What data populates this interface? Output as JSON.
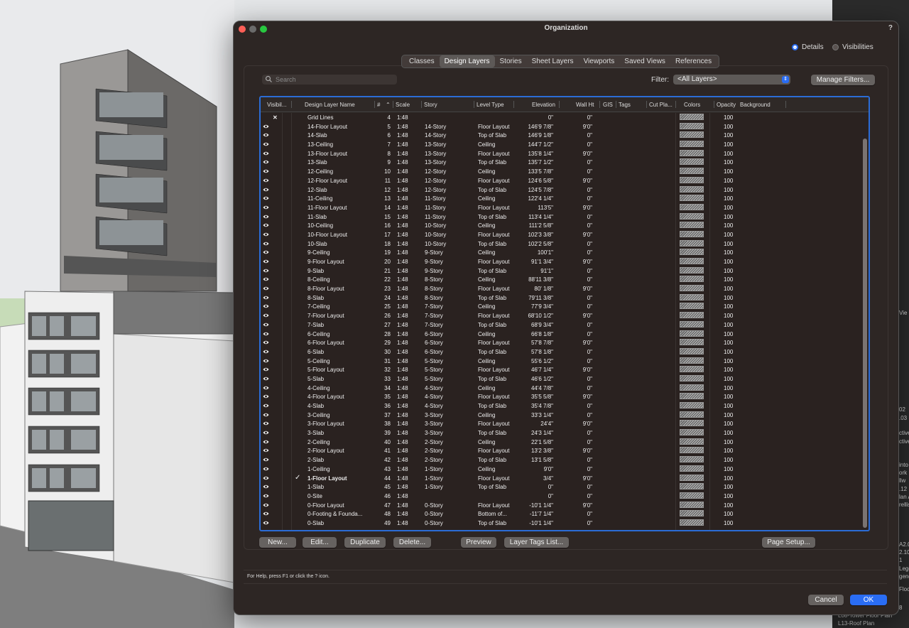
{
  "dialog": {
    "title": "Organization",
    "help": "?",
    "modes": {
      "details": "Details",
      "visibilities": "Visibilities"
    },
    "tabs": [
      "Classes",
      "Design Layers",
      "Stories",
      "Sheet Layers",
      "Viewports",
      "Saved Views",
      "References"
    ],
    "active_tab": "Design Layers",
    "search_placeholder": "Search",
    "filter_label": "Filter:",
    "filter_value": "<All Layers>",
    "manage_filters": "Manage Filters...",
    "columns": {
      "visibility": "Visibil...",
      "name": "Design Layer Name",
      "num": "#",
      "scale": "Scale",
      "story": "Story",
      "level": "Level Type",
      "elevation": "Elevation",
      "wall": "Wall Ht",
      "gis": "GIS",
      "tags": "Tags",
      "cut": "Cut Pla...",
      "colors": "Colors",
      "opacity": "Opacity",
      "background": "Background"
    },
    "rows": [
      {
        "vis": "hidden",
        "active": false,
        "name": "Grid Lines",
        "num": "4",
        "scale": "1:48",
        "story": "",
        "level": "",
        "elev": "0\"",
        "wall": "0\"",
        "opacity": "100"
      },
      {
        "vis": "visible",
        "active": false,
        "name": "14-Floor Layout",
        "num": "5",
        "scale": "1:48",
        "story": "14-Story",
        "level": "Floor Layout",
        "elev": "146'9 7/8\"",
        "wall": "9'0\"",
        "opacity": "100"
      },
      {
        "vis": "visible",
        "active": false,
        "name": "14-Slab",
        "num": "6",
        "scale": "1:48",
        "story": "14-Story",
        "level": "Top of Slab",
        "elev": "146'9 1/8\"",
        "wall": "0\"",
        "opacity": "100"
      },
      {
        "vis": "visible",
        "active": false,
        "name": "13-Ceiling",
        "num": "7",
        "scale": "1:48",
        "story": "13-Story",
        "level": "Ceiling",
        "elev": "144'7 1/2\"",
        "wall": "0\"",
        "opacity": "100"
      },
      {
        "vis": "visible",
        "active": false,
        "name": "13-Floor Layout",
        "num": "8",
        "scale": "1:48",
        "story": "13-Story",
        "level": "Floor Layout",
        "elev": "135'8 1/4\"",
        "wall": "9'0\"",
        "opacity": "100"
      },
      {
        "vis": "visible",
        "active": false,
        "name": "13-Slab",
        "num": "9",
        "scale": "1:48",
        "story": "13-Story",
        "level": "Top of Slab",
        "elev": "135'7 1/2\"",
        "wall": "0\"",
        "opacity": "100"
      },
      {
        "vis": "visible",
        "active": false,
        "name": "12-Ceiling",
        "num": "10",
        "scale": "1:48",
        "story": "12-Story",
        "level": "Ceiling",
        "elev": "133'5 7/8\"",
        "wall": "0\"",
        "opacity": "100"
      },
      {
        "vis": "visible",
        "active": false,
        "name": "12-Floor Layout",
        "num": "11",
        "scale": "1:48",
        "story": "12-Story",
        "level": "Floor Layout",
        "elev": "124'6 5/8\"",
        "wall": "9'0\"",
        "opacity": "100"
      },
      {
        "vis": "visible",
        "active": false,
        "name": "12-Slab",
        "num": "12",
        "scale": "1:48",
        "story": "12-Story",
        "level": "Top of Slab",
        "elev": "124'5 7/8\"",
        "wall": "0\"",
        "opacity": "100"
      },
      {
        "vis": "visible",
        "active": false,
        "name": "11-Ceiling",
        "num": "13",
        "scale": "1:48",
        "story": "11-Story",
        "level": "Ceiling",
        "elev": "122'4 1/4\"",
        "wall": "0\"",
        "opacity": "100"
      },
      {
        "vis": "visible",
        "active": false,
        "name": "11-Floor Layout",
        "num": "14",
        "scale": "1:48",
        "story": "11-Story",
        "level": "Floor Layout",
        "elev": "113'5\"",
        "wall": "9'0\"",
        "opacity": "100"
      },
      {
        "vis": "visible",
        "active": false,
        "name": "11-Slab",
        "num": "15",
        "scale": "1:48",
        "story": "11-Story",
        "level": "Top of Slab",
        "elev": "113'4 1/4\"",
        "wall": "0\"",
        "opacity": "100"
      },
      {
        "vis": "visible",
        "active": false,
        "name": "10-Ceiling",
        "num": "16",
        "scale": "1:48",
        "story": "10-Story",
        "level": "Ceiling",
        "elev": "111'2 5/8\"",
        "wall": "0\"",
        "opacity": "100"
      },
      {
        "vis": "visible",
        "active": false,
        "name": "10-Floor Layout",
        "num": "17",
        "scale": "1:48",
        "story": "10-Story",
        "level": "Floor Layout",
        "elev": "102'3 3/8\"",
        "wall": "9'0\"",
        "opacity": "100"
      },
      {
        "vis": "visible",
        "active": false,
        "name": "10-Slab",
        "num": "18",
        "scale": "1:48",
        "story": "10-Story",
        "level": "Top of Slab",
        "elev": "102'2 5/8\"",
        "wall": "0\"",
        "opacity": "100"
      },
      {
        "vis": "visible",
        "active": false,
        "name": "9-Ceiling",
        "num": "19",
        "scale": "1:48",
        "story": "9-Story",
        "level": "Ceiling",
        "elev": "100'1\"",
        "wall": "0\"",
        "opacity": "100"
      },
      {
        "vis": "visible",
        "active": false,
        "name": "9-Floor Layout",
        "num": "20",
        "scale": "1:48",
        "story": "9-Story",
        "level": "Floor Layout",
        "elev": "91'1 3/4\"",
        "wall": "9'0\"",
        "opacity": "100"
      },
      {
        "vis": "visible",
        "active": false,
        "name": "9-Slab",
        "num": "21",
        "scale": "1:48",
        "story": "9-Story",
        "level": "Top of Slab",
        "elev": "91'1\"",
        "wall": "0\"",
        "opacity": "100"
      },
      {
        "vis": "visible",
        "active": false,
        "name": "8-Ceiling",
        "num": "22",
        "scale": "1:48",
        "story": "8-Story",
        "level": "Ceiling",
        "elev": "88'11 3/8\"",
        "wall": "0\"",
        "opacity": "100"
      },
      {
        "vis": "visible",
        "active": false,
        "name": "8-Floor Layout",
        "num": "23",
        "scale": "1:48",
        "story": "8-Story",
        "level": "Floor Layout",
        "elev": "80' 1/8\"",
        "wall": "9'0\"",
        "opacity": "100"
      },
      {
        "vis": "visible",
        "active": false,
        "name": "8-Slab",
        "num": "24",
        "scale": "1:48",
        "story": "8-Story",
        "level": "Top of Slab",
        "elev": "79'11 3/8\"",
        "wall": "0\"",
        "opacity": "100"
      },
      {
        "vis": "visible",
        "active": false,
        "name": "7-Ceiling",
        "num": "25",
        "scale": "1:48",
        "story": "7-Story",
        "level": "Ceiling",
        "elev": "77'9 3/4\"",
        "wall": "0\"",
        "opacity": "100"
      },
      {
        "vis": "visible",
        "active": false,
        "name": "7-Floor Layout",
        "num": "26",
        "scale": "1:48",
        "story": "7-Story",
        "level": "Floor Layout",
        "elev": "68'10 1/2\"",
        "wall": "9'0\"",
        "opacity": "100"
      },
      {
        "vis": "visible",
        "active": false,
        "name": "7-Slab",
        "num": "27",
        "scale": "1:48",
        "story": "7-Story",
        "level": "Top of Slab",
        "elev": "68'9 3/4\"",
        "wall": "0\"",
        "opacity": "100"
      },
      {
        "vis": "visible",
        "active": false,
        "name": "6-Ceiling",
        "num": "28",
        "scale": "1:48",
        "story": "6-Story",
        "level": "Ceiling",
        "elev": "66'8 1/8\"",
        "wall": "0\"",
        "opacity": "100"
      },
      {
        "vis": "visible",
        "active": false,
        "name": "6-Floor Layout",
        "num": "29",
        "scale": "1:48",
        "story": "6-Story",
        "level": "Floor Layout",
        "elev": "57'8 7/8\"",
        "wall": "9'0\"",
        "opacity": "100"
      },
      {
        "vis": "visible",
        "active": false,
        "name": "6-Slab",
        "num": "30",
        "scale": "1:48",
        "story": "6-Story",
        "level": "Top of Slab",
        "elev": "57'8 1/8\"",
        "wall": "0\"",
        "opacity": "100"
      },
      {
        "vis": "visible",
        "active": false,
        "name": "5-Ceiling",
        "num": "31",
        "scale": "1:48",
        "story": "5-Story",
        "level": "Ceiling",
        "elev": "55'6 1/2\"",
        "wall": "0\"",
        "opacity": "100"
      },
      {
        "vis": "visible",
        "active": false,
        "name": "5-Floor Layout",
        "num": "32",
        "scale": "1:48",
        "story": "5-Story",
        "level": "Floor Layout",
        "elev": "46'7 1/4\"",
        "wall": "9'0\"",
        "opacity": "100"
      },
      {
        "vis": "visible",
        "active": false,
        "name": "5-Slab",
        "num": "33",
        "scale": "1:48",
        "story": "5-Story",
        "level": "Top of Slab",
        "elev": "46'6 1/2\"",
        "wall": "0\"",
        "opacity": "100"
      },
      {
        "vis": "visible",
        "active": false,
        "name": "4-Ceiling",
        "num": "34",
        "scale": "1:48",
        "story": "4-Story",
        "level": "Ceiling",
        "elev": "44'4 7/8\"",
        "wall": "0\"",
        "opacity": "100"
      },
      {
        "vis": "visible",
        "active": false,
        "name": "4-Floor Layout",
        "num": "35",
        "scale": "1:48",
        "story": "4-Story",
        "level": "Floor Layout",
        "elev": "35'5 5/8\"",
        "wall": "9'0\"",
        "opacity": "100"
      },
      {
        "vis": "visible",
        "active": false,
        "name": "4-Slab",
        "num": "36",
        "scale": "1:48",
        "story": "4-Story",
        "level": "Top of Slab",
        "elev": "35'4 7/8\"",
        "wall": "0\"",
        "opacity": "100"
      },
      {
        "vis": "visible",
        "active": false,
        "name": "3-Ceiling",
        "num": "37",
        "scale": "1:48",
        "story": "3-Story",
        "level": "Ceiling",
        "elev": "33'3 1/4\"",
        "wall": "0\"",
        "opacity": "100"
      },
      {
        "vis": "visible",
        "active": false,
        "name": "3-Floor Layout",
        "num": "38",
        "scale": "1:48",
        "story": "3-Story",
        "level": "Floor Layout",
        "elev": "24'4\"",
        "wall": "9'0\"",
        "opacity": "100"
      },
      {
        "vis": "visible",
        "active": false,
        "name": "3-Slab",
        "num": "39",
        "scale": "1:48",
        "story": "3-Story",
        "level": "Top of Slab",
        "elev": "24'3 1/4\"",
        "wall": "0\"",
        "opacity": "100"
      },
      {
        "vis": "visible",
        "active": false,
        "name": "2-Ceiling",
        "num": "40",
        "scale": "1:48",
        "story": "2-Story",
        "level": "Ceiling",
        "elev": "22'1 5/8\"",
        "wall": "0\"",
        "opacity": "100"
      },
      {
        "vis": "visible",
        "active": false,
        "name": "2-Floor Layout",
        "num": "41",
        "scale": "1:48",
        "story": "2-Story",
        "level": "Floor Layout",
        "elev": "13'2 3/8\"",
        "wall": "9'0\"",
        "opacity": "100"
      },
      {
        "vis": "visible",
        "active": false,
        "name": "2-Slab",
        "num": "42",
        "scale": "1:48",
        "story": "2-Story",
        "level": "Top of Slab",
        "elev": "13'1 5/8\"",
        "wall": "0\"",
        "opacity": "100"
      },
      {
        "vis": "visible",
        "active": false,
        "name": "1-Ceiling",
        "num": "43",
        "scale": "1:48",
        "story": "1-Story",
        "level": "Ceiling",
        "elev": "9'0\"",
        "wall": "0\"",
        "opacity": "100"
      },
      {
        "vis": "visible",
        "active": true,
        "name": "1-Floor Layout",
        "num": "44",
        "scale": "1:48",
        "story": "1-Story",
        "level": "Floor Layout",
        "elev": "3/4\"",
        "wall": "9'0\"",
        "opacity": "100"
      },
      {
        "vis": "visible",
        "active": false,
        "name": "1-Slab",
        "num": "45",
        "scale": "1:48",
        "story": "1-Story",
        "level": "Top of Slab",
        "elev": "0\"",
        "wall": "0\"",
        "opacity": "100"
      },
      {
        "vis": "visible",
        "active": false,
        "name": "0-Site",
        "num": "46",
        "scale": "1:48",
        "story": "",
        "level": "",
        "elev": "0\"",
        "wall": "0\"",
        "opacity": "100"
      },
      {
        "vis": "visible",
        "active": false,
        "name": "0-Floor Layout",
        "num": "47",
        "scale": "1:48",
        "story": "0-Story",
        "level": "Floor Layout",
        "elev": "-10'1 1/4\"",
        "wall": "9'0\"",
        "opacity": "100"
      },
      {
        "vis": "visible",
        "active": false,
        "name": "0-Footing & Founda...",
        "num": "48",
        "scale": "1:48",
        "story": "0-Story",
        "level": "Bottom of...",
        "elev": "-11'7 1/4\"",
        "wall": "0\"",
        "opacity": "100"
      },
      {
        "vis": "visible",
        "active": false,
        "name": "0-Slab",
        "num": "49",
        "scale": "1:48",
        "story": "0-Story",
        "level": "Top of Slab",
        "elev": "-10'1 1/4\"",
        "wall": "0\"",
        "opacity": "100"
      }
    ],
    "buttons": {
      "new": "New...",
      "edit": "Edit...",
      "duplicate": "Duplicate",
      "delete": "Delete...",
      "preview": "Preview",
      "layer_tags": "Layer Tags List...",
      "page_setup": "Page Setup...",
      "cancel": "Cancel",
      "ok": "OK"
    },
    "status_text": "For Help, press F1 or click the ? icon."
  },
  "right_strip": {
    "fragments": [
      "Vie",
      "02",
      ".03",
      "ctive",
      "ctive",
      "into",
      "ork",
      "llw",
      ".12",
      "lan A",
      "rellis",
      "A2.0",
      "2.10",
      "1",
      "Lege",
      "gend",
      "Floo",
      "8"
    ],
    "bottom_items": [
      "L08-Tower Floor Plan",
      "L13-Roof Plan"
    ]
  },
  "colors": {
    "accent": "#2a6df4",
    "dialog_bg": "#2d2624",
    "selection_border": "#2b6cd6"
  }
}
